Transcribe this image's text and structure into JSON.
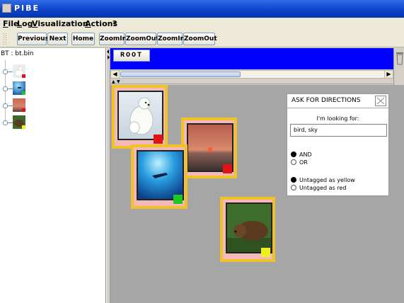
{
  "window": {
    "title": "PIBE"
  },
  "menu": {
    "items": [
      "File",
      "Log",
      "Visualization",
      "Actions",
      "?"
    ]
  },
  "toolbar": {
    "buttons": [
      "Previous",
      "Next",
      "Home",
      "ZoomIn",
      "ZoomOut",
      "ZoomIn",
      "ZoomOut"
    ]
  },
  "tree": {
    "root_label": "BT : bt.bin",
    "nodes": [
      {
        "name": "polar-bear",
        "tag_color": "#e01414"
      },
      {
        "name": "diver",
        "tag_color": "#1ec81e"
      },
      {
        "name": "sunset",
        "tag_color": "#e01414"
      },
      {
        "name": "brown-bear",
        "tag_color": "#f0f020"
      }
    ]
  },
  "breadcrumb": {
    "root_label": "ROOT"
  },
  "cards": [
    {
      "name": "polar-bear",
      "tag_color": "#e01414"
    },
    {
      "name": "sunset",
      "tag_color": "#e01414"
    },
    {
      "name": "diver",
      "tag_color": "#1ec81e"
    },
    {
      "name": "brown-bear",
      "tag_color": "#f0f020"
    }
  ],
  "dialog": {
    "title": "ASK FOR DIRECTIONS",
    "looking_for_label": "I'm looking for:",
    "query": "bird, sky",
    "logic_options": [
      {
        "label": "AND",
        "selected": true
      },
      {
        "label": "OR",
        "selected": false
      }
    ],
    "tag_options": [
      {
        "label": "Untagged as yellow",
        "selected": true
      },
      {
        "label": "Untagged as red",
        "selected": false
      }
    ]
  },
  "colors": {
    "titlebar": "#0a3fc8",
    "breadcrumb_band": "#0000ff",
    "card_border": "#f0c226",
    "card_fill": "#f3b9b9",
    "canvas": "#a6a6a6"
  }
}
